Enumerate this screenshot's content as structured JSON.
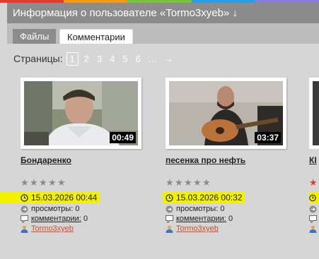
{
  "accent_colors": [
    "#e23b2e",
    "#f39a1e",
    "#7bc043",
    "#2e9be6",
    "#8a7fd4"
  ],
  "header": {
    "title": "Информация о пользователе «Tormo3xyeb» ↓"
  },
  "tabs": [
    {
      "label": "Файлы",
      "active": true
    },
    {
      "label": "Комментарии",
      "active": false
    }
  ],
  "pager": {
    "label": "Страницы:",
    "current": "1",
    "pages": [
      "2",
      "3",
      "4",
      "5",
      "6"
    ],
    "ellipsis": "…",
    "next": "→"
  },
  "videos": [
    {
      "title": "Бондаренко",
      "duration": "00:49",
      "rating": 0,
      "date": "15.03.2026 00:44",
      "views_label": "просмотры:",
      "views": "0",
      "comments_label": "комментарии:",
      "comments": "0",
      "author": "Tormo3xyeb"
    },
    {
      "title": "песенка про нефть",
      "duration": "03:37",
      "rating": 0,
      "date": "15.03.2026 00:32",
      "views_label": "просмотры:",
      "views": "0",
      "comments_label": "комментарии:",
      "comments": "0",
      "author": "Tormo3xyeb"
    },
    {
      "title": "КI",
      "rating": 1
    }
  ]
}
